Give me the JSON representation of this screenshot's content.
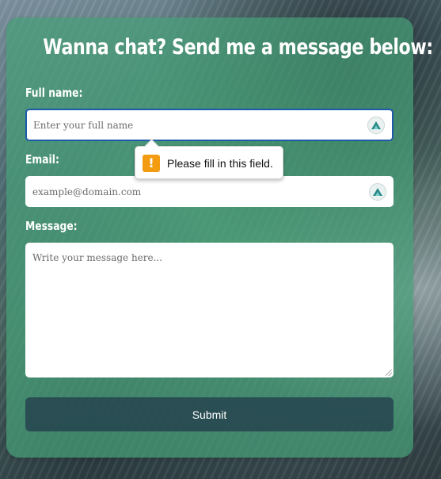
{
  "form": {
    "title": "Wanna chat? Send me a message below:",
    "full_name": {
      "label": "Full name:",
      "placeholder": "Enter your full name",
      "value": ""
    },
    "email": {
      "label": "Email:",
      "placeholder": "example@domain.com",
      "value": ""
    },
    "message": {
      "label": "Message:",
      "placeholder": "Write your message here...",
      "value": ""
    },
    "submit_label": "Submit"
  },
  "validation_tooltip": {
    "icon": "warning-icon",
    "text": "Please fill in this field."
  },
  "password_manager_icon": "password-manager-icon",
  "colors": {
    "card_background": "#46a078",
    "focus_border": "#1e5aa8",
    "submit_background": "#264650",
    "warning": "#f39c12"
  }
}
